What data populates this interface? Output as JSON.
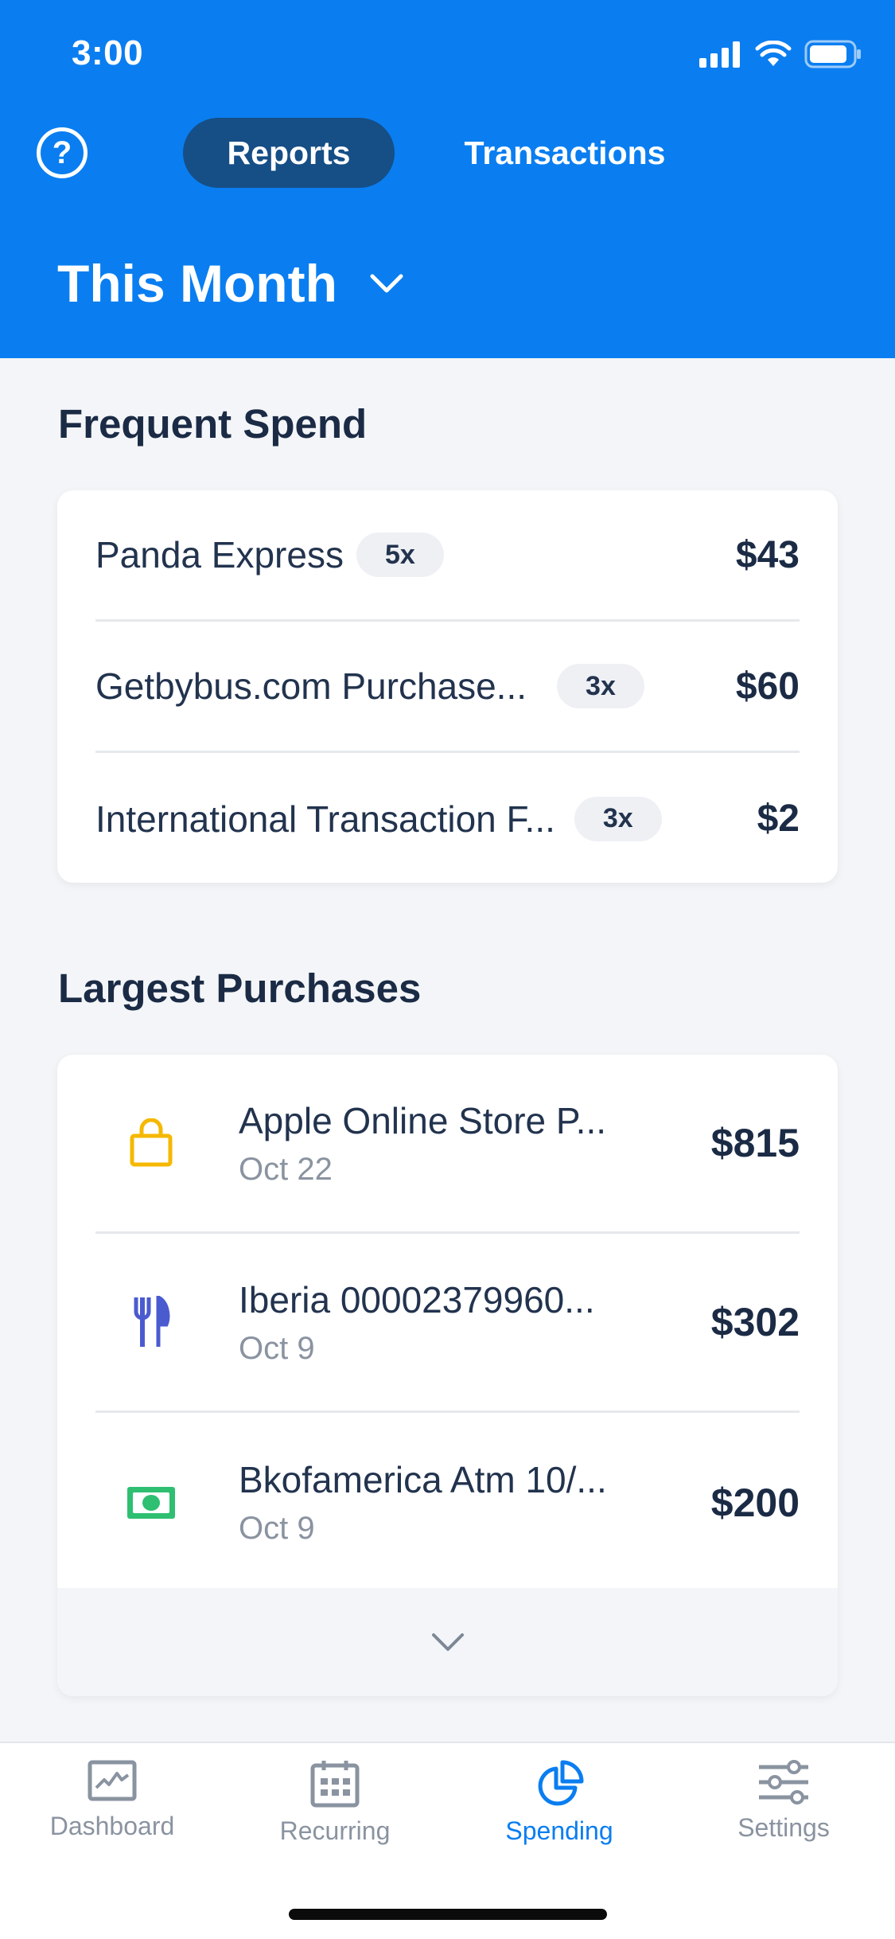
{
  "status_bar": {
    "time": "3:00"
  },
  "header": {
    "help_icon": "question-circle-icon",
    "tabs": [
      {
        "label": "Reports",
        "active": true
      },
      {
        "label": "Transactions",
        "active": false
      }
    ],
    "period_label": "This Month"
  },
  "frequent_spend": {
    "title": "Frequent Spend",
    "items": [
      {
        "name": "Panda Express",
        "count": "5x",
        "amount": "$43"
      },
      {
        "name": "Getbybus.com Purchase...",
        "count": "3x",
        "amount": "$60"
      },
      {
        "name": "International Transaction F...",
        "count": "3x",
        "amount": "$2"
      }
    ]
  },
  "largest_purchases": {
    "title": "Largest Purchases",
    "items": [
      {
        "icon": "shopping-bag-icon",
        "name": "Apple Online Store P...",
        "date": "Oct 22",
        "amount": "$815",
        "color": "#f5b800"
      },
      {
        "icon": "fork-knife-icon",
        "name": "Iberia 00002379960...",
        "date": "Oct 9",
        "amount": "$302",
        "color": "#4a5bd0"
      },
      {
        "icon": "cash-icon",
        "name": "Bkofamerica Atm 10/...",
        "date": "Oct 9",
        "amount": "$200",
        "color": "#2fbf71"
      }
    ]
  },
  "tabbar": {
    "items": [
      {
        "label": "Dashboard",
        "icon": "dashboard-chart-icon",
        "active": false
      },
      {
        "label": "Recurring",
        "icon": "calendar-icon",
        "active": false
      },
      {
        "label": "Spending",
        "icon": "pie-chart-icon",
        "active": true
      },
      {
        "label": "Settings",
        "icon": "sliders-icon",
        "active": false
      }
    ]
  },
  "colors": {
    "accent": "#0a7ef0",
    "accent_dark": "#164e86"
  }
}
